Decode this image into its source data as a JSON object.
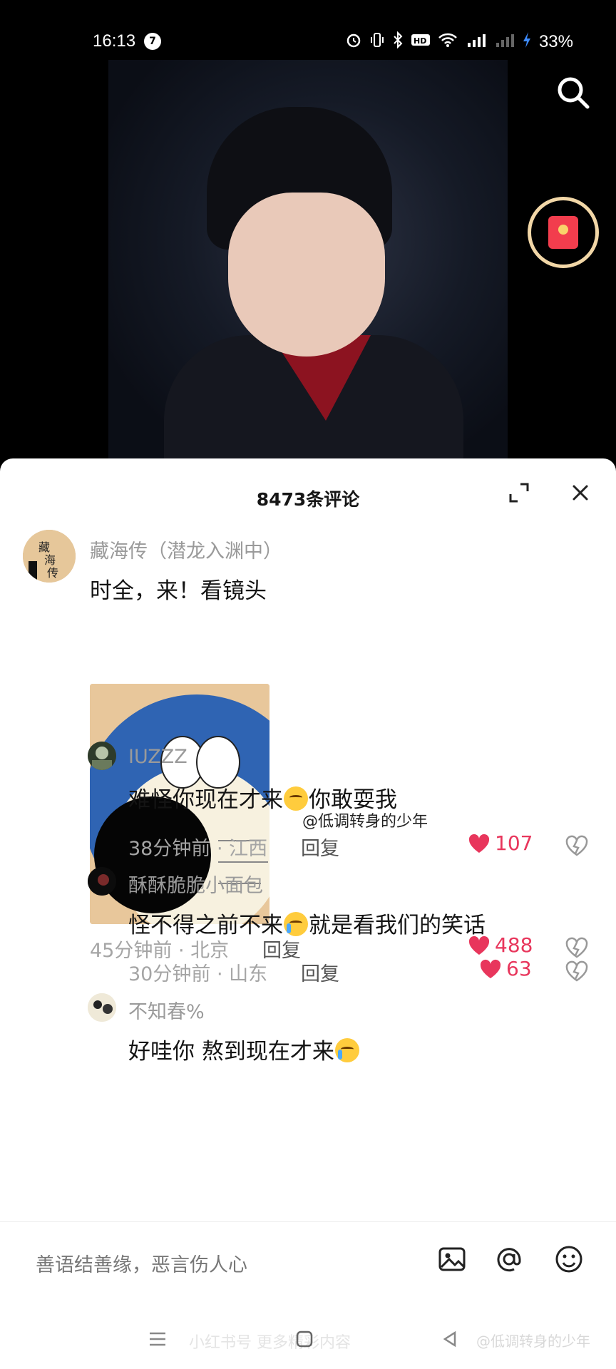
{
  "status_bar": {
    "time": "16:13",
    "notification_count": "7",
    "battery": "33%"
  },
  "video": {
    "search_icon": "search-icon",
    "red_packet_icon": "red-envelope-icon"
  },
  "comments_panel": {
    "title": "8473条评论",
    "expand_icon": "expand-icon",
    "close_icon": "close-icon"
  },
  "comments": [
    {
      "username": "藏海传（潜龙入渊中）",
      "avatar_text": "藏海传",
      "text": "时全，来！看镜头",
      "meta": "45分钟前 · 北京",
      "reply_label": "回复",
      "likes": "488",
      "has_sticker": true
    },
    {
      "username": "IUZZZ",
      "text_before": "难怪你现在才来",
      "text_after": "你敢耍我",
      "mention": "@低调转身的少年",
      "meta": "38分钟前 · 江西",
      "reply_label": "回复",
      "likes": "107"
    },
    {
      "username": "酥酥脆脆小面包",
      "text_before": "怪不得之前不来",
      "text_after": "就是看我们的笑话",
      "meta": "30分钟前 · 山东",
      "reply_label": "回复",
      "likes": "63"
    },
    {
      "username": "不知春%",
      "text_before": "好哇你  熬到现在才来",
      "text_after": ""
    }
  ],
  "input_bar": {
    "placeholder": "善语结善缘，恶言伤人心",
    "icons": [
      "image-icon",
      "at-icon",
      "emoji-icon"
    ]
  },
  "watermark": {
    "center": "小红书号 更多精彩内容",
    "right": "@低调转身的少年"
  },
  "colors": {
    "like": "#e8365c",
    "sheet_bg": "#ffffff",
    "video_bg": "#000000"
  }
}
